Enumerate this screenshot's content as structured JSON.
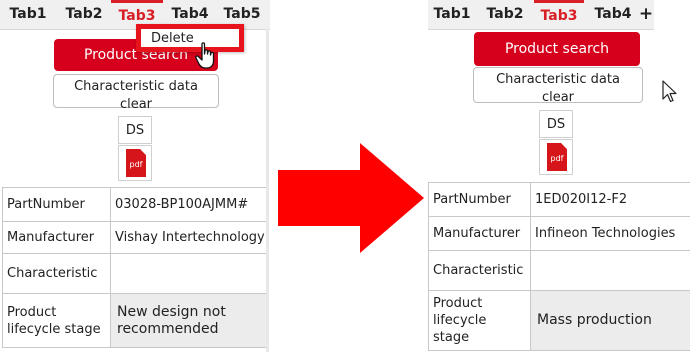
{
  "colors": {
    "accent": "#d81f26",
    "button_red": "#d6001c",
    "arrow_red": "#ff0000",
    "menu_border": "#e8141d"
  },
  "before": {
    "tabs": [
      "Tab1",
      "Tab2",
      "Tab3",
      "Tab4",
      "Tab5"
    ],
    "active_tab": "Tab3",
    "context_menu": {
      "item": "Delete"
    },
    "product_search_label": "Product search",
    "clear_button": {
      "line1": "Characteristic data",
      "line2": "clear"
    },
    "ds_label": "DS",
    "pdf_label": "pdf",
    "rows": [
      {
        "label": "PartNumber",
        "value": "03028-BP100AJMM#"
      },
      {
        "label": "Manufacturer",
        "value": "Vishay Intertechnology"
      },
      {
        "label": "Characteristic",
        "value": ""
      },
      {
        "label": "Product lifecycle stage",
        "value": "New design not recommended"
      }
    ]
  },
  "after": {
    "tabs": [
      "Tab1",
      "Tab2",
      "Tab3",
      "Tab4"
    ],
    "active_tab": "Tab3",
    "add_tab_label": "+",
    "product_search_label": "Product search",
    "clear_button": {
      "line1": "Characteristic data",
      "line2": "clear"
    },
    "ds_label": "DS",
    "pdf_label": "pdf",
    "rows": [
      {
        "label": "PartNumber",
        "value": "1ED020I12-F2"
      },
      {
        "label": "Manufacturer",
        "value": "Infineon Technologies"
      },
      {
        "label": "Characteristic",
        "value": ""
      },
      {
        "label": "Product lifecycle stage",
        "value": "Mass production"
      }
    ]
  }
}
